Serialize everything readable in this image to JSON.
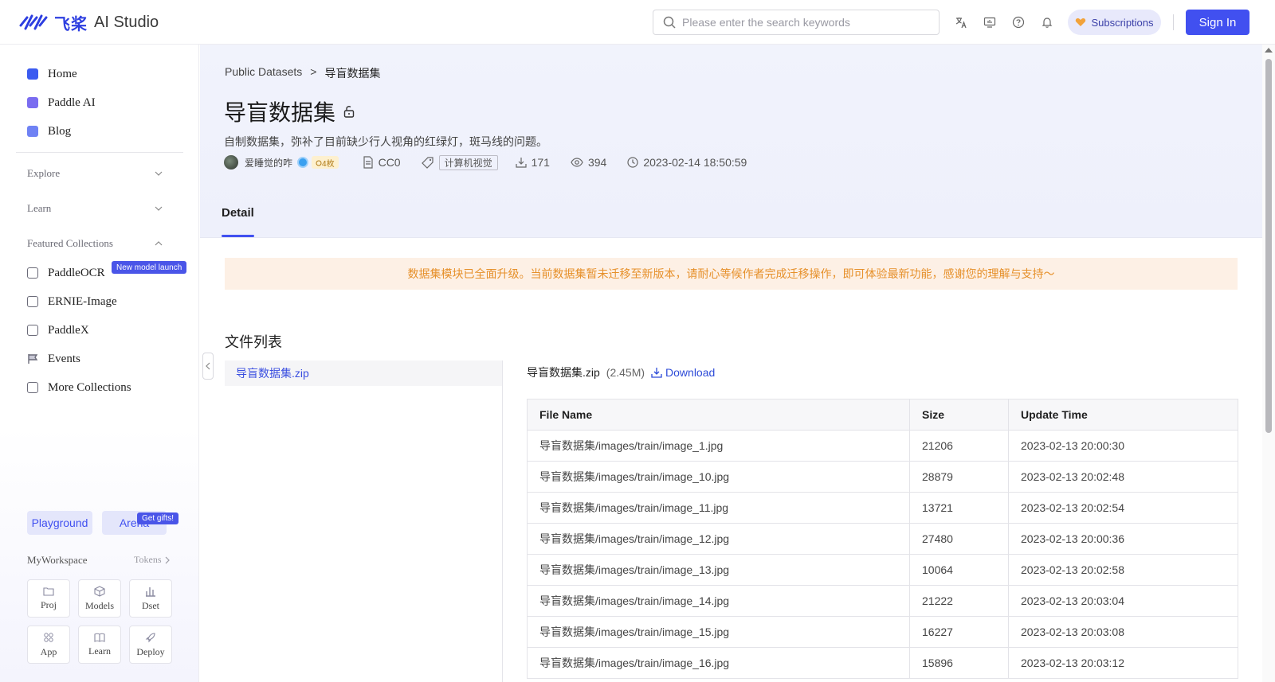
{
  "header": {
    "logo_cn": "飞桨",
    "logo_en": "AI Studio",
    "search_placeholder": "Please enter the search keywords",
    "icons": [
      "translate-icon",
      "monitor-icon",
      "help-icon",
      "bell-icon"
    ],
    "subscriptions_label": "Subscriptions",
    "sign_in_label": "Sign In"
  },
  "sidebar": {
    "items": [
      {
        "label": "Home",
        "icon": "home-icon"
      },
      {
        "label": "Paddle AI",
        "icon": "paddle-ai-icon"
      },
      {
        "label": "Blog",
        "icon": "blog-icon"
      }
    ],
    "sections": {
      "explore": "Explore",
      "learn": "Learn",
      "featured": "Featured Collections"
    },
    "featured_items": [
      {
        "label": "PaddleOCR",
        "icon": "ocr-icon"
      },
      {
        "label": "ERNIE-Image",
        "icon": "image-icon"
      },
      {
        "label": "PaddleX",
        "icon": "paddlex-icon"
      },
      {
        "label": "Events",
        "icon": "flag-icon"
      },
      {
        "label": "More Collections",
        "icon": "collection-icon"
      }
    ],
    "new_badge": "New model launch",
    "playground_label": "Playground",
    "arena_label": "Arena",
    "gift_badge": "Get gifts!",
    "workspace_title": "MyWorkspace",
    "tokens_label": "Tokens",
    "tiles": [
      "Proj",
      "Models",
      "Dset",
      "App",
      "Learn",
      "Deploy"
    ]
  },
  "breadcrumb": {
    "parent": "Public Datasets",
    "separator": ">",
    "current": "导盲数据集"
  },
  "dataset": {
    "title": "导盲数据集",
    "description": "自制数据集，弥补了目前缺少行人视角的红绿灯，斑马线的问题。",
    "author": "爱睡觉的咋",
    "medal": "4枚",
    "license": "CC0",
    "tag": "计算机视觉",
    "downloads": "171",
    "views": "394",
    "updated": "2023-02-14 18:50:59"
  },
  "tabs": {
    "detail": "Detail"
  },
  "notice": "数据集模块已全面升级。当前数据集暂未迁移至新版本，请耐心等候作者完成迁移操作，即可体验最新功能，感谢您的理解与支持～",
  "file_list": {
    "heading": "文件列表",
    "selected_file": "导盲数据集.zip",
    "file_name": "导盲数据集.zip",
    "file_size": "(2.45M)",
    "download_label": "Download",
    "columns": [
      "File Name",
      "Size",
      "Update Time"
    ],
    "rows": [
      [
        "导盲数据集/images/train/image_1.jpg",
        "21206",
        "2023-02-13 20:00:30"
      ],
      [
        "导盲数据集/images/train/image_10.jpg",
        "28879",
        "2023-02-13 20:02:48"
      ],
      [
        "导盲数据集/images/train/image_11.jpg",
        "13721",
        "2023-02-13 20:02:54"
      ],
      [
        "导盲数据集/images/train/image_12.jpg",
        "27480",
        "2023-02-13 20:00:36"
      ],
      [
        "导盲数据集/images/train/image_13.jpg",
        "10064",
        "2023-02-13 20:02:58"
      ],
      [
        "导盲数据集/images/train/image_14.jpg",
        "21222",
        "2023-02-13 20:03:04"
      ],
      [
        "导盲数据集/images/train/image_15.jpg",
        "16227",
        "2023-02-13 20:03:08"
      ],
      [
        "导盲数据集/images/train/image_16.jpg",
        "15896",
        "2023-02-13 20:03:12"
      ]
    ]
  },
  "colors": {
    "accent": "#4150f0",
    "notice_bg": "#fdf0e5",
    "notice_text": "#e6902a",
    "link": "#2d4bd8"
  }
}
